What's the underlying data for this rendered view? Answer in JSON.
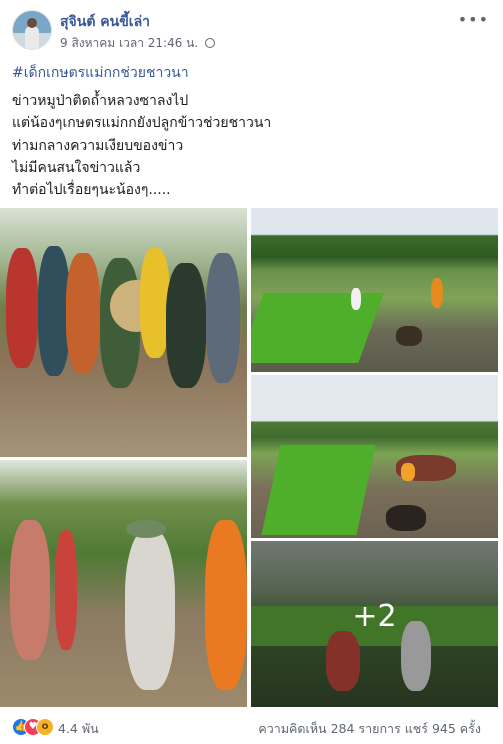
{
  "post": {
    "author": "สุจินต์ คนขี้เล่า",
    "timestamp": "9 สิงหาคม เวลา 21:46 น.",
    "hashtag": "#เด็กเกษตรแม่กกช่วยชาวนา",
    "text_lines": [
      "ข่าวหมูป่าติดถ้ำหลวงซาลงไป",
      "แต่น้องๆเกษตรแม่กกยังปลูกข้าวช่วยชาวนา",
      "ท่ามกลางความเงียบของข่าว",
      "ไม่มีคนสนใจข่าวแล้ว",
      "ทำต่อไปเรื่อยๆนะน้องๆ....."
    ],
    "more_photos": "+2"
  },
  "footer": {
    "reaction_count": "4.4 พัน",
    "comments": "ความคิดเห็น 284 รายการ",
    "shares": "แชร์ 945 ครั้ง"
  },
  "icons": {
    "more": "more-options-icon",
    "privacy": "globe-icon",
    "reactions": [
      "like-icon",
      "love-icon",
      "wow-icon"
    ]
  },
  "colors": {
    "link": "#385898",
    "meta": "#606770",
    "like": "#1877f2",
    "love": "#f33e58",
    "wow": "#f7b125"
  }
}
